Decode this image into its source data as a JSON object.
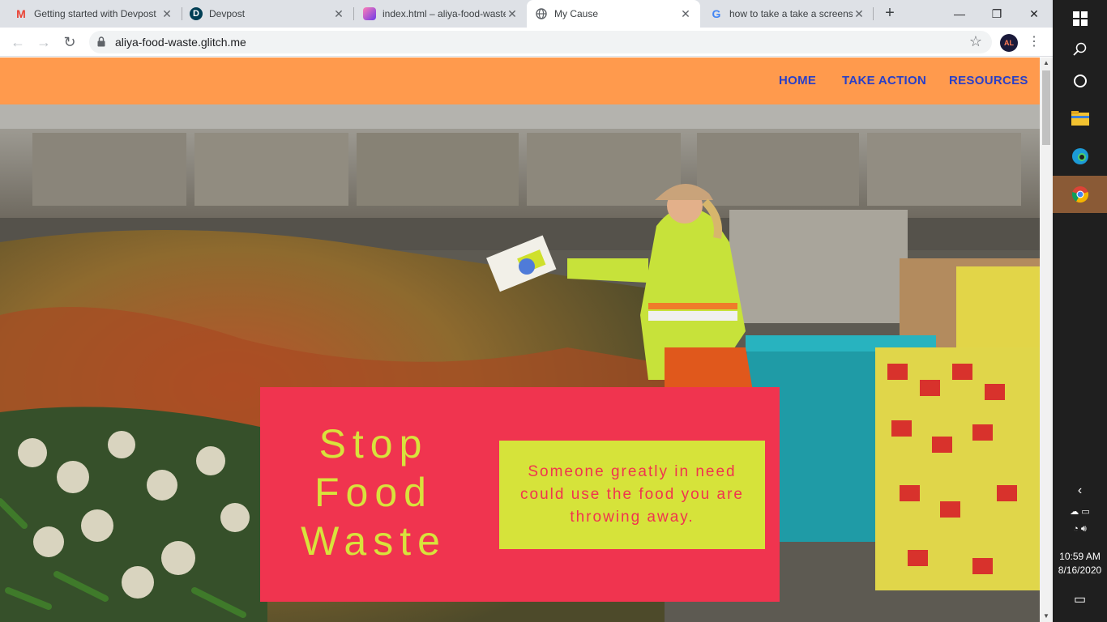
{
  "browser": {
    "tabs": [
      {
        "title": "Getting started with Devpost",
        "icon": "gmail-icon"
      },
      {
        "title": "Devpost",
        "icon": "devpost-icon"
      },
      {
        "title": "index.html – aliya-food-waste",
        "icon": "glitch-icon"
      },
      {
        "title": "My Cause",
        "icon": "globe-icon"
      },
      {
        "title": "how to take a take a screenshot",
        "icon": "google-icon"
      }
    ],
    "active_tab": 3,
    "url": "aliya-food-waste.glitch.me",
    "profile_initials": "AL"
  },
  "site": {
    "nav": [
      "HOME",
      "TAKE ACTION",
      "RESOURCES"
    ],
    "headline": [
      "Stop",
      "Food",
      "Waste"
    ],
    "message": "Someone greatly in need could use the food you are throwing away.",
    "colors": {
      "nav_bg": "#ff9a4d",
      "nav_link": "#2a3fc7",
      "card_bg": "#f0344f",
      "accent": "#d6e33a"
    }
  },
  "taskbar": {
    "time": "10:59 AM",
    "date": "8/16/2020"
  }
}
